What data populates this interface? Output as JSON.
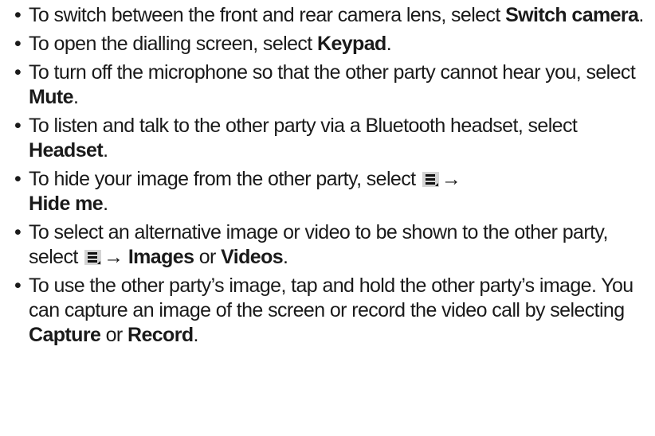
{
  "bullet_symbol": "•",
  "arrow": "→",
  "icons": {
    "menu": "menu-icon"
  },
  "items": [
    {
      "t1": "To switch between the front and rear camera lens, select ",
      "k1": "Switch camera",
      "t2": "."
    },
    {
      "t1": "To open the dialling screen, select ",
      "k1": "Keypad",
      "t2": "."
    },
    {
      "t1": "To turn off the microphone so that the other party cannot hear you, select ",
      "k1": "Mute",
      "t2": "."
    },
    {
      "t1": "To listen and talk to the other party via a Bluetooth headset, select ",
      "k1": "Headset",
      "t2": "."
    },
    {
      "t1": "To hide your image from the other party, select ",
      "k1": "Hide me",
      "t2": "."
    },
    {
      "t1": "To select an alternative image or video to be shown to the other party, select ",
      "k1": "Images",
      "t2": " or ",
      "k2": "Videos",
      "t3": "."
    },
    {
      "t1": "To use the other party’s image, tap and hold the other party’s image. You can capture an image of the screen or record the video call by selecting ",
      "k1": "Capture",
      "t2": " or ",
      "k2": "Record",
      "t3": "."
    }
  ]
}
